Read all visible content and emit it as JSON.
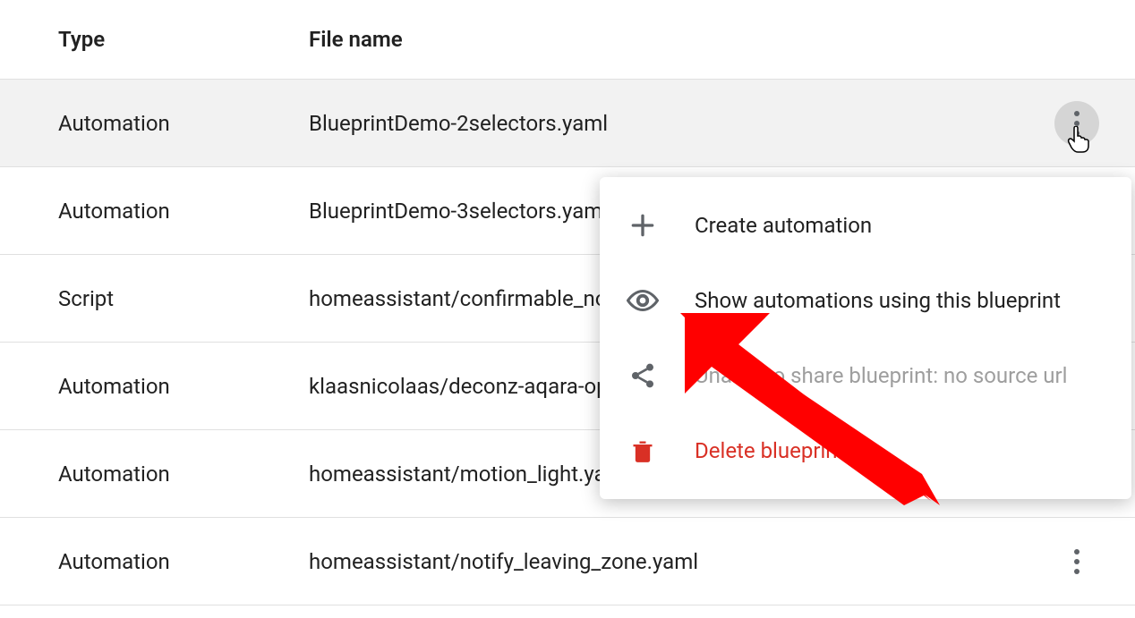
{
  "headers": {
    "type": "Type",
    "filename": "File name"
  },
  "rows": [
    {
      "type": "Automation",
      "filename": "BlueprintDemo-2selectors.yaml",
      "highlighted": true,
      "showMore": true,
      "moreActive": true
    },
    {
      "type": "Automation",
      "filename": "BlueprintDemo-3selectors.yaml",
      "highlighted": false,
      "showMore": false,
      "moreActive": false
    },
    {
      "type": "Script",
      "filename": "homeassistant/confirmable_no",
      "highlighted": false,
      "showMore": false,
      "moreActive": false
    },
    {
      "type": "Automation",
      "filename": "klaasnicolaas/deconz-aqara-op",
      "highlighted": false,
      "showMore": false,
      "moreActive": false
    },
    {
      "type": "Automation",
      "filename": "homeassistant/motion_light.ya",
      "highlighted": false,
      "showMore": false,
      "moreActive": false
    },
    {
      "type": "Automation",
      "filename": "homeassistant/notify_leaving_zone.yaml",
      "highlighted": false,
      "showMore": true,
      "moreActive": false
    }
  ],
  "menu": {
    "create": "Create automation",
    "show": "Show automations using this blueprint",
    "share": "Unable to share blueprint: no source url",
    "delete": "Delete blueprint"
  }
}
